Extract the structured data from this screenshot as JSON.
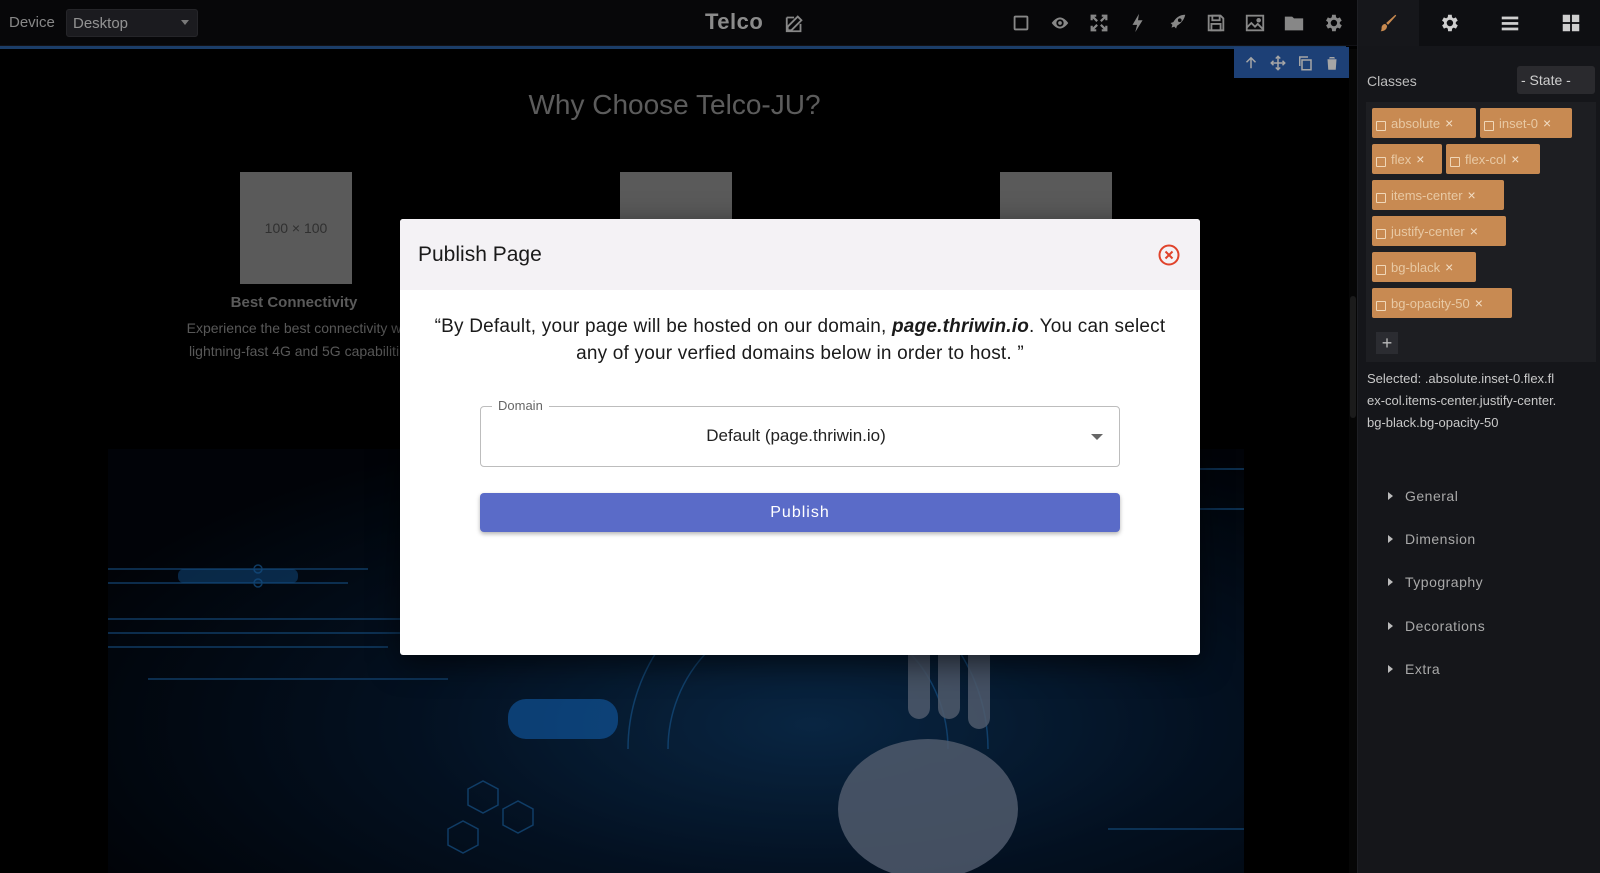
{
  "toolbar": {
    "device_label": "Device",
    "device_value": "Desktop",
    "project_title": "Telco",
    "icons": [
      "square-icon",
      "eye-icon",
      "fullscreen-icon",
      "bolt-icon",
      "rocket-icon",
      "save-icon",
      "image-icon",
      "folder-icon",
      "gear-icon"
    ]
  },
  "component_toolbar": {
    "icons": [
      "arrow-up-icon",
      "move-icon",
      "copy-icon",
      "trash-icon"
    ]
  },
  "canvas": {
    "heading": "Why Choose Telco-JU?",
    "placeholder_text": "100 × 100",
    "feature_title": "Best Connectivity",
    "feature_desc_line1": "Experience the best connectivity w",
    "feature_desc_line2": "lightning-fast 4G and 5G capabiliti"
  },
  "panel": {
    "tabs": [
      "paintbrush-icon",
      "gear-icon",
      "menu-icon",
      "blocks-icon"
    ],
    "classes_label": "Classes",
    "state_value": "- State -",
    "tags": [
      "absolute",
      "inset-0",
      "flex",
      "flex-col",
      "items-center",
      "justify-center",
      "bg-black",
      "bg-opacity-50"
    ],
    "add_label": "+",
    "selected_text": "Selected: .absolute.inset-0.flex.flex-col.items-center.justify-center.bg-black.bg-opacity-50",
    "sections": [
      "General",
      "Dimension",
      "Typography",
      "Decorations",
      "Extra"
    ]
  },
  "modal": {
    "title": "Publish Page",
    "message_part1": "“By Default, your page will be hosted on our domain, ",
    "message_domain": "page.thriwin.io",
    "message_part2": ". You can select any of your verfied domains below in order to host. ”",
    "domain_label": "Domain",
    "domain_value": "Default (page.thriwin.io)",
    "publish_label": "Publish"
  },
  "colors": {
    "accent": "#5a6bc8",
    "tag": "#c88a52",
    "close": "#e0432b",
    "selection": "#2d63b5"
  }
}
